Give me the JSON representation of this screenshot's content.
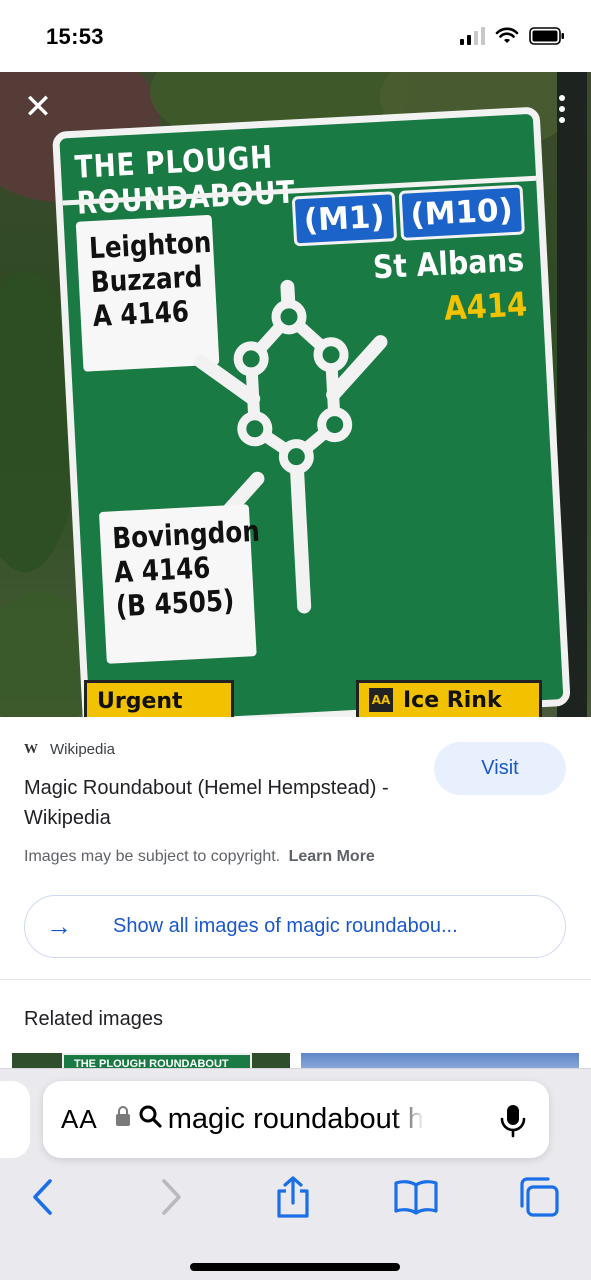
{
  "status_bar": {
    "time": "15:53"
  },
  "image_viewer": {
    "close_icon": "close-icon",
    "more_icon": "more-vertical-icon",
    "sign": {
      "title": "THE PLOUGH ROUNDABOUT",
      "left_top": [
        "Leighton",
        "Buzzard",
        "A 4146"
      ],
      "left_bottom": [
        "Bovingdon",
        "A 4146",
        "(B 4505)"
      ],
      "motorways": [
        "(M1)",
        "(M10)"
      ],
      "right_destination": "St Albans",
      "right_road": "A414",
      "sub_left": "Urgent",
      "sub_right": "Ice Rink",
      "sub_right_badge": "AA"
    },
    "colors": {
      "sign_green": "#1a7a43",
      "motorway_blue": "#1c63c9",
      "road_yellow": "#f3c300"
    }
  },
  "result": {
    "source_icon": "W",
    "source_name": "Wikipedia",
    "title": "Magic Roundabout (Hemel Hempstead) - Wikipedia",
    "visit_label": "Visit",
    "copyright_text": "Images may be subject to copyright.",
    "learn_more": "Learn More",
    "show_all_label": "Show all images of magic roundabou..."
  },
  "related": {
    "title": "Related images",
    "thumb_1_text": "THE PLOUGH ROUNDABOUT"
  },
  "browser": {
    "aa_label": "AA",
    "url_text": "magic roundabout h",
    "icons": [
      "back-icon",
      "forward-icon",
      "share-icon",
      "bookmarks-icon",
      "tabs-icon",
      "mic-icon",
      "lock-icon",
      "search-icon"
    ]
  }
}
